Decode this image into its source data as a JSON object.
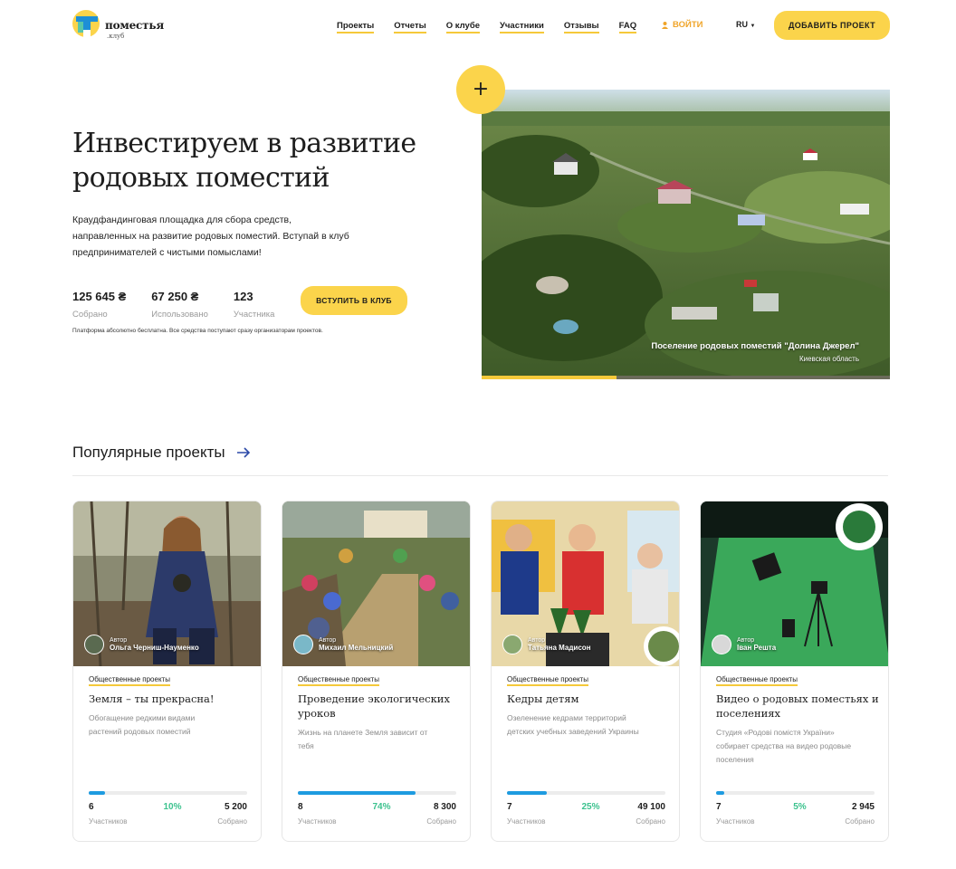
{
  "brand": {
    "name": "поместья",
    "sub": ".клуб"
  },
  "nav": [
    "Проекты",
    "Отчеты",
    "О клубе",
    "Участники",
    "Отзывы",
    "FAQ"
  ],
  "login": "ВОЙТИ",
  "lang": "RU",
  "add_project": "ДОБАВИТЬ ПРОЕКТ",
  "hero": {
    "title": "Инвестируем в развитие родовых поместий",
    "desc": "Краудфандинговая площадка для сбора средств, направленных на развитие родовых поместий. Вступай в клуб предпринимателей с чистыми помыслами!",
    "stats": [
      {
        "value": "125 645 ₴",
        "label": "Собрано"
      },
      {
        "value": "67 250 ₴",
        "label": "Использовано"
      },
      {
        "value": "123",
        "label": "Участника"
      }
    ],
    "join": "ВСТУПИТЬ В КЛУБ",
    "note": "Платформа абсолютно бесплатна. Все средства поступают сразу организаторам проектов.",
    "caption_title": "Поселение родовых поместий \"Долина Джерел\"",
    "caption_region": "Киевская область",
    "slide_progress": 0.33,
    "plus": "+"
  },
  "popular": {
    "title": "Популярные проекты",
    "cards": [
      {
        "author_label": "Автор",
        "author": "Ольга Черниш-Науменко",
        "category": "Общественные проекты",
        "title": "Земля – ты прекрасна!",
        "desc": "Обогащение редкими видами растений родовых поместий",
        "participants": "6",
        "participants_label": "Участников",
        "percent": "10%",
        "progress": 0.1,
        "collected": "5 200",
        "collected_label": "Собрано"
      },
      {
        "author_label": "Автор",
        "author": "Михаил Мельницкий",
        "category": "Общественные проекты",
        "title": "Проведение экологических уроков",
        "desc": "Жизнь на планете Земля зависит от тебя",
        "participants": "8",
        "participants_label": "Участников",
        "percent": "74%",
        "progress": 0.74,
        "collected": "8 300",
        "collected_label": "Собрано"
      },
      {
        "author_label": "Автор",
        "author": "Татьяна Мадисон",
        "category": "Общественные проекты",
        "title": "Кедры детям",
        "desc": "Озеленение кедрами территорий детских учебных заведений Украины",
        "participants": "7",
        "participants_label": "Участников",
        "percent": "25%",
        "progress": 0.25,
        "collected": "49 100",
        "collected_label": "Собрано"
      },
      {
        "author_label": "Автор",
        "author": "Іван Решта",
        "category": "Общественные проекты",
        "title": "Видео о родовых поместьях и поселениях",
        "desc": "Студия «Родові помістя України» собирает средства на видео родовые поселения",
        "participants": "7",
        "participants_label": "Участников",
        "percent": "5%",
        "progress": 0.05,
        "collected": "2 945",
        "collected_label": "Собрано"
      }
    ]
  }
}
